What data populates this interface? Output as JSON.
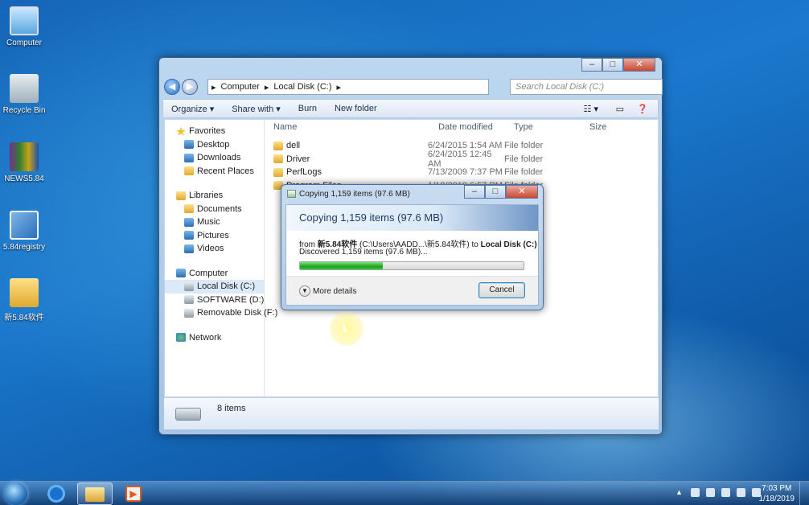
{
  "desktop": {
    "icons": [
      {
        "label": "Computer",
        "icon": "computer-icon"
      },
      {
        "label": "Recycle Bin",
        "icon": "recycle-bin-icon"
      },
      {
        "label": "NEWS5.84",
        "icon": "winrar-archive-icon"
      },
      {
        "label": "5.84registry",
        "icon": "registry-file-icon"
      },
      {
        "label": "新5.84软件",
        "icon": "folder-icon"
      }
    ]
  },
  "explorer": {
    "address": [
      "Computer",
      "Local Disk (C:)"
    ],
    "search_placeholder": "Search Local Disk (C:)",
    "toolbar": {
      "organize": "Organize",
      "share": "Share with",
      "burn": "Burn",
      "new_folder": "New folder"
    },
    "nav": {
      "favorites": "Favorites",
      "desktop": "Desktop",
      "downloads": "Downloads",
      "recent": "Recent Places",
      "libraries": "Libraries",
      "documents": "Documents",
      "music": "Music",
      "pictures": "Pictures",
      "videos": "Videos",
      "computer": "Computer",
      "local_disk": "Local Disk (C:)",
      "software": "SOFTWARE (D:)",
      "removable": "Removable Disk (F:)",
      "network": "Network"
    },
    "columns": {
      "name": "Name",
      "date": "Date modified",
      "type": "Type",
      "size": "Size"
    },
    "rows": [
      {
        "name": "dell",
        "date": "6/24/2015 1:54 AM",
        "type": "File folder"
      },
      {
        "name": "Driver",
        "date": "6/24/2015 12:45 AM",
        "type": "File folder"
      },
      {
        "name": "PerfLogs",
        "date": "7/13/2009 7:37 PM",
        "type": "File folder"
      },
      {
        "name": "Program Files",
        "date": "1/18/2019 6:57 PM",
        "type": "File folder"
      }
    ],
    "status": "8 items"
  },
  "dialog": {
    "title": "Copying 1,159 items (97.6 MB)",
    "heading": "Copying 1,159 items (97.6 MB)",
    "from_label": "from",
    "from_name": "新5.84软件",
    "from_path": "(C:\\Users\\AADD...\\新5.84软件)",
    "to_label": "to",
    "to_name": "Local Disk (C:)",
    "discovered": "Discovered 1,159 items (97.6 MB)...",
    "progress": 0.37,
    "more_details": "More details",
    "cancel": "Cancel"
  },
  "taskbar": {
    "time": "7:03 PM",
    "date": "1/18/2019"
  }
}
